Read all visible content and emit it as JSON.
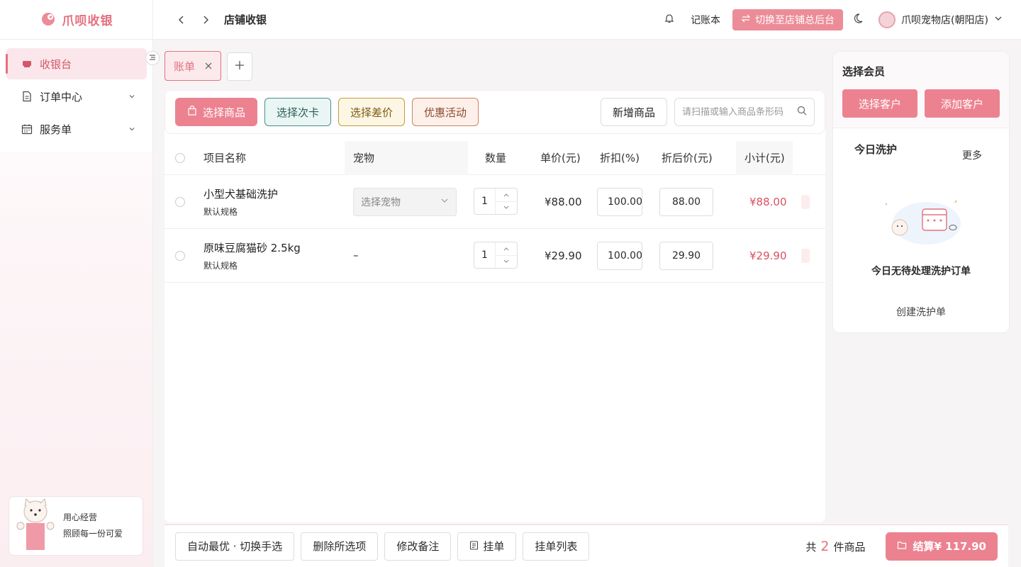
{
  "app": {
    "name": "爪呗收银",
    "page_title": "店铺收银"
  },
  "header": {
    "ledger_label": "记账本",
    "switch_label": "切换至店铺总后台",
    "store_name": "爪呗宠物店(朝阳店)"
  },
  "sidebar": {
    "items": [
      {
        "label": "收银台",
        "icon": "cashier-icon",
        "active": true
      },
      {
        "label": "订单中心",
        "icon": "document-icon",
        "expandable": true
      },
      {
        "label": "服务单",
        "icon": "calendar-icon",
        "expandable": true
      }
    ],
    "promo": {
      "line1": "用心经营",
      "line2": "照顾每一份可爱"
    }
  },
  "tabs": [
    {
      "label": "账单"
    }
  ],
  "toolbar": {
    "select_product": "选择商品",
    "select_card": "选择次卡",
    "select_diff": "选择差价",
    "promotions": "优惠活动",
    "add_product": "新增商品",
    "search_placeholder": "请扫描或输入商品条形码"
  },
  "table": {
    "headers": {
      "name": "项目名称",
      "pet": "宠物",
      "qty": "数量",
      "price": "单价(元)",
      "discount": "折扣(%)",
      "after": "折后价(元)",
      "subtotal": "小计(元)"
    },
    "rows": [
      {
        "name": "小型犬基础洗护",
        "spec": "默认规格",
        "pet": "选择宠物",
        "qty": "1",
        "price": "¥88.00",
        "discount": "100.00",
        "after": "88.00",
        "subtotal": "¥88.00"
      },
      {
        "name": "原味豆腐猫砂 2.5kg",
        "spec": "默认规格",
        "pet": "–",
        "qty": "1",
        "price": "¥29.90",
        "discount": "100.00",
        "after": "29.90",
        "subtotal": "¥29.90"
      }
    ]
  },
  "footer": {
    "auto_label": "自动最优 · 切换手选",
    "delete_label": "删除所选项",
    "remark_label": "修改备注",
    "hang_label": "挂单",
    "hang_list_label": "挂单列表",
    "total_prefix": "共",
    "total_count": "2",
    "total_suffix": "件商品",
    "checkout_label": "结算¥ 117.90"
  },
  "member": {
    "title": "选择会员",
    "select_customer": "选择客户",
    "add_customer": "添加客户",
    "wash_title": "今日洗护",
    "more": "更多",
    "empty_text": "今日无待处理洗护订单",
    "create_label": "创建洗护单"
  },
  "colors": {
    "brand": "#e5707f",
    "button_pink": "#ec8290",
    "price_red": "#d9505f"
  }
}
